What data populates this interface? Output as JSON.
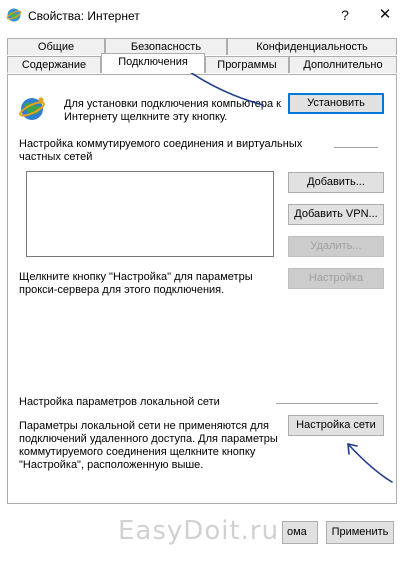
{
  "window": {
    "title": "Свойства: Интернет",
    "help_label": "?",
    "close_label": "✕"
  },
  "tabs": {
    "row_back": [
      {
        "label": "Общие"
      },
      {
        "label": "Безопасность"
      },
      {
        "label": "Конфиденциальность"
      }
    ],
    "row_front": [
      {
        "label": "Содержание"
      },
      {
        "label": "Подключения",
        "active": true
      },
      {
        "label": "Программы"
      },
      {
        "label": "Дополнительно"
      }
    ]
  },
  "setup": {
    "text": "Для установки подключения компьютера к Интернету щелкните эту кнопку.",
    "button": "Установить"
  },
  "dialup": {
    "header": "Настройка коммутируемого соединения и виртуальных частных сетей",
    "buttons": {
      "add": "Добавить...",
      "add_vpn": "Добавить VPN...",
      "remove": "Удалить...",
      "settings": "Настройка"
    },
    "proxy_hint": "Щелкните кнопку \"Настройка\" для параметры прокси-сервера для этого подключения."
  },
  "lan": {
    "header": "Настройка параметров локальной сети",
    "text": "Параметры локальной сети не применяются для подключений удаленного доступа. Для параметры коммутируемого соединения щелкните кнопку \"Настройка\", расположенную выше.",
    "button": "Настройка сети"
  },
  "footer": {
    "watermark": "EasyDoit.ru",
    "ok_partial": "ома",
    "apply": "Применить"
  }
}
